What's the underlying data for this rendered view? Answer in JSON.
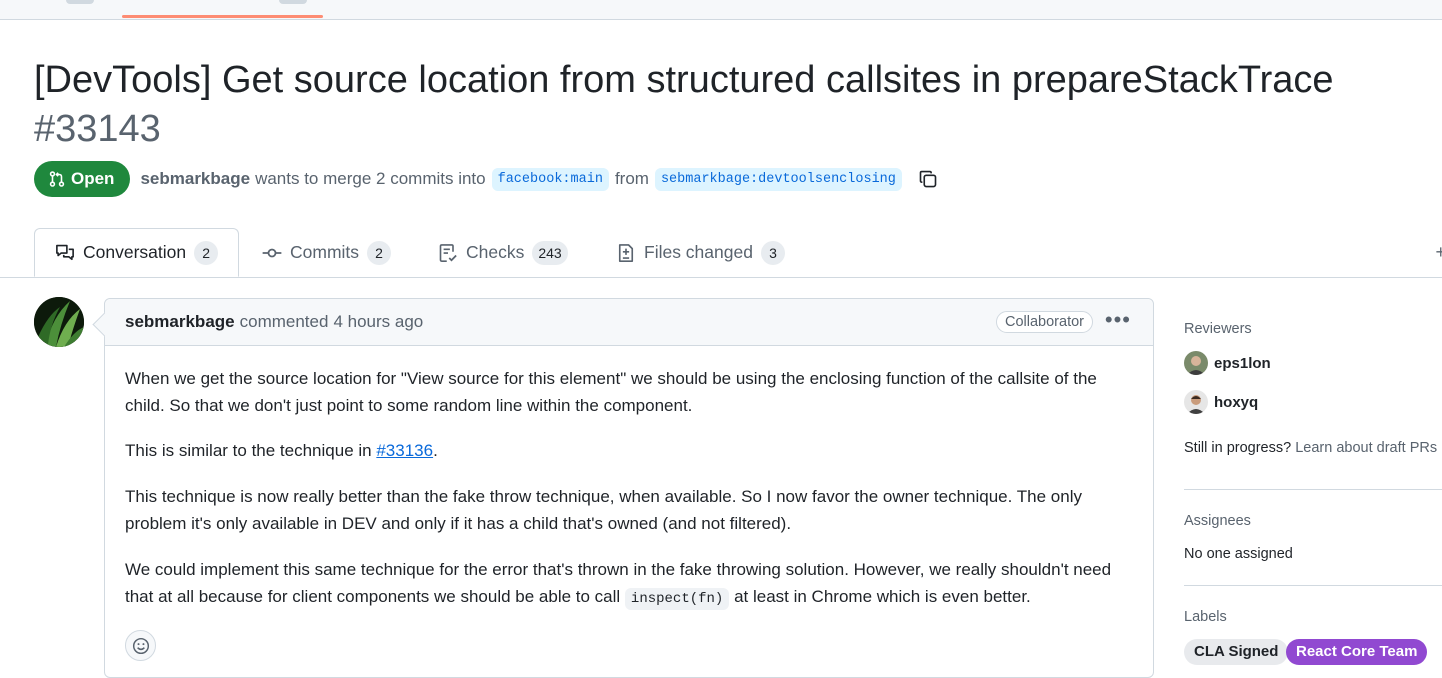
{
  "pull_request": {
    "title": "[DevTools] Get source location from structured callsites in prepareStackTrace",
    "number": "#33143",
    "state": "Open",
    "author": "sebmarkbage",
    "merge_text": "wants to merge 2 commits into",
    "base_branch": "facebook:main",
    "from_word": "from",
    "head_branch": "sebmarkbage:devtoolsenclosing"
  },
  "tabs": [
    {
      "label": "Conversation",
      "count": "2",
      "icon": "comment-discussion-icon"
    },
    {
      "label": "Commits",
      "count": "2",
      "icon": "git-commit-icon"
    },
    {
      "label": "Checks",
      "count": "243",
      "icon": "checklist-icon"
    },
    {
      "label": "Files changed",
      "count": "3",
      "icon": "file-diff-icon"
    }
  ],
  "comment": {
    "author": "sebmarkbage",
    "action": "commented",
    "time": "4 hours ago",
    "role": "Collaborator",
    "p1": "When we get the source location for \"View source for this element\" we should be using the enclosing function of the callsite of the child. So that we don't just point to some random line within the component.",
    "p2_before": "This is similar to the technique in ",
    "p2_link": "#33136",
    "p2_after": ".",
    "p3": "This technique is now really better than the fake throw technique, when available. So I now favor the owner technique. The only problem it's only available in DEV and only if it has a child that's owned (and not filtered).",
    "p4_before": "We could implement this same technique for the error that's thrown in the fake throwing solution. However, we really shouldn't need that at all because for client components we should be able to call ",
    "p4_code": "inspect(fn)",
    "p4_after": " at least in Chrome which is even better."
  },
  "sidebar": {
    "reviewers_heading": "Reviewers",
    "reviewers": [
      "eps1lon",
      "hoxyq"
    ],
    "draft_prefix": "Still in progress?",
    "draft_link": "Learn about draft PRs",
    "assignees_heading": "Assignees",
    "assignees_value": "No one assigned",
    "labels_heading": "Labels",
    "labels": [
      {
        "name": "CLA Signed",
        "bg": "#e8eaed",
        "fg": "#1f2328"
      },
      {
        "name": "React Core Team",
        "bg": "#9149d1",
        "fg": "#ffffff"
      }
    ]
  },
  "colors": {
    "open_green": "#1f883d",
    "link_blue": "#0969da",
    "tab_underline": "#fd8c73"
  }
}
